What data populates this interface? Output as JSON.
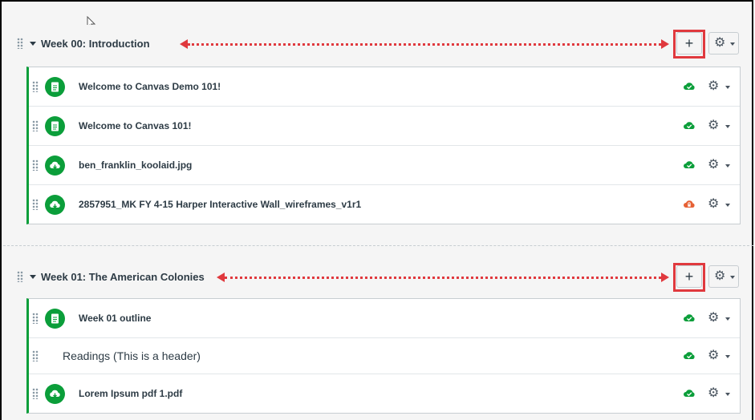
{
  "modules": [
    {
      "title": "Week 00: Introduction",
      "add_label": "+",
      "items": [
        {
          "type": "page",
          "label": "Welcome to Canvas Demo 101!",
          "status": "published"
        },
        {
          "type": "file",
          "label": "Welcome to Canvas 101!",
          "status": "published",
          "icon": "page"
        },
        {
          "type": "file",
          "label": "ben_franklin_koolaid.jpg",
          "status": "published"
        },
        {
          "type": "file",
          "label": "2857951_MK FY 4-15 Harper Interactive Wall_wireframes_v1r1",
          "status": "unpublished"
        }
      ]
    },
    {
      "title": "Week 01: The American Colonies",
      "add_label": "+",
      "items": [
        {
          "type": "page",
          "label": "Week 01 outline",
          "status": "published"
        },
        {
          "type": "header",
          "label": "Readings (This is a header)",
          "status": "published"
        },
        {
          "type": "file",
          "label": "Lorem Ipsum pdf 1.pdf",
          "status": "published"
        }
      ]
    }
  ],
  "colors": {
    "accent_green": "#0b9e3a",
    "annotation_red": "#e0393e",
    "unpublished_orange": "#e66135"
  }
}
